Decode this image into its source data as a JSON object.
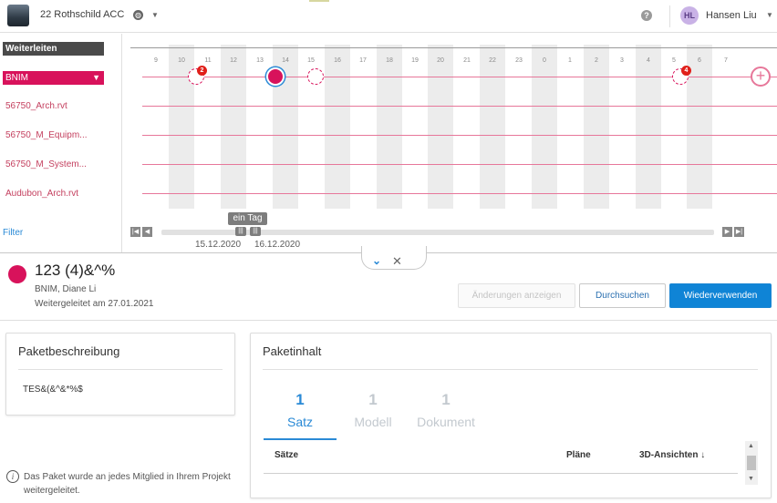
{
  "header": {
    "project_name": "22 Rothschild ACC",
    "user_initials": "HL",
    "user_name": "Hansen Liu",
    "help_label": "?"
  },
  "sidebar": {
    "forwarded_label": "Weiterleiten",
    "team_label": "BNIM",
    "files": [
      "56750_Arch.rvt",
      "56750_M_Equipm...",
      "56750_M_System...",
      "Audubon_Arch.rvt"
    ],
    "filter_label": "Filter"
  },
  "timeline": {
    "days": [
      "9",
      "10",
      "11",
      "12",
      "13",
      "14",
      "15",
      "16",
      "17",
      "18",
      "19",
      "20",
      "21",
      "22",
      "23",
      "0",
      "1",
      "2",
      "3",
      "4",
      "5",
      "6",
      "7"
    ],
    "badges": [
      "2",
      "4"
    ],
    "range_label": "ein Tag",
    "date_start": "15.12.2020",
    "date_end": "16.12.2020"
  },
  "package": {
    "title": "123 (4)&^%",
    "owner": "BNIM, Diane Li",
    "forwarded_on": "Weitergeleitet am 27.01.2021",
    "btn_changes": "Änderungen anzeigen",
    "btn_browse": "Durchsuchen",
    "btn_reuse": "Wiederverwenden"
  },
  "description": {
    "title": "Paketbeschreibung",
    "text": "TES&(&^&*%$"
  },
  "notice": "Das Paket wurde an jedes Mitglied in Ihrem Projekt weitergeleitet.",
  "contents": {
    "title": "Paketinhalt",
    "tabs": [
      {
        "count": "1",
        "label": "Satz"
      },
      {
        "count": "1",
        "label": "Modell"
      },
      {
        "count": "1",
        "label": "Dokument"
      }
    ],
    "columns": [
      "Sätze",
      "Pläne",
      "3D-Ansichten ↓"
    ]
  },
  "colors": {
    "accent": "#d8125b",
    "primary": "#0f84d6",
    "link": "#2a8ad6"
  }
}
